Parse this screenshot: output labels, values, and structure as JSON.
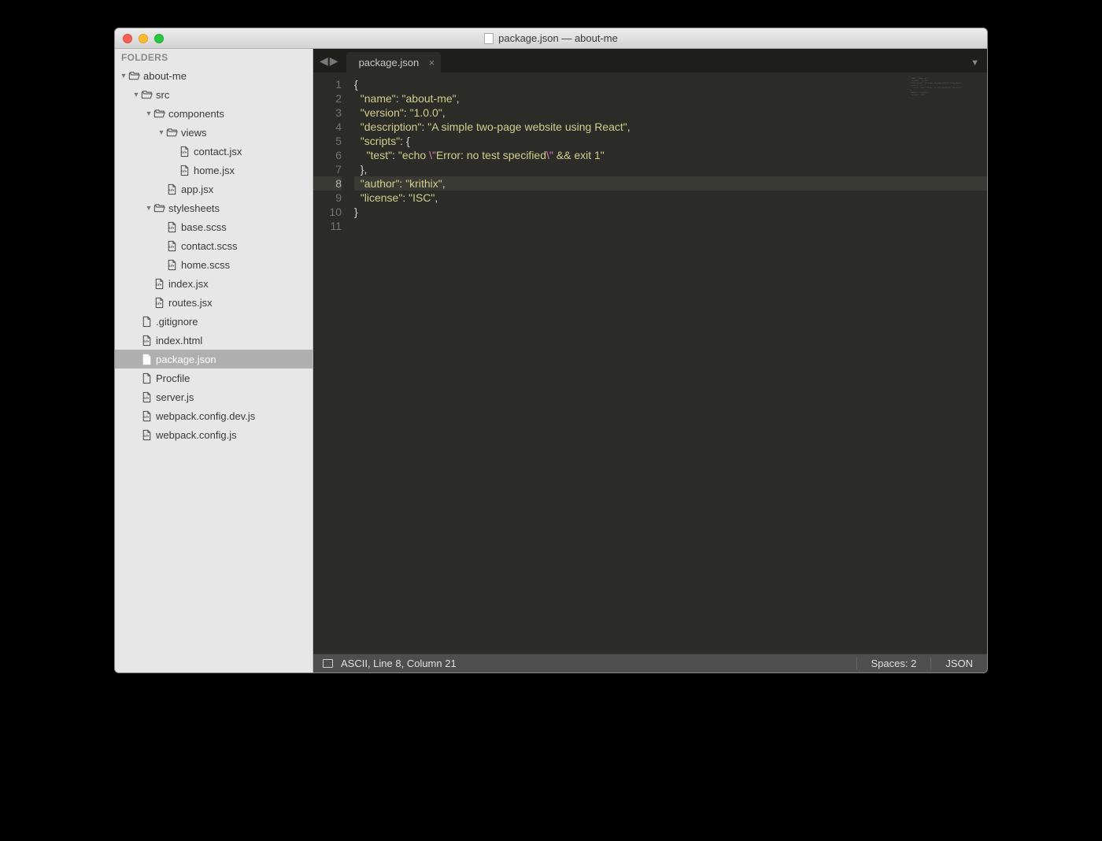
{
  "window": {
    "title": "package.json — about-me"
  },
  "sidebar": {
    "header": "FOLDERS",
    "tree": [
      {
        "depth": 0,
        "kind": "folder",
        "open": true,
        "name": "about-me"
      },
      {
        "depth": 1,
        "kind": "folder",
        "open": true,
        "name": "src"
      },
      {
        "depth": 2,
        "kind": "folder",
        "open": true,
        "name": "components"
      },
      {
        "depth": 3,
        "kind": "folder",
        "open": true,
        "name": "views"
      },
      {
        "depth": 4,
        "kind": "file-code",
        "name": "contact.jsx"
      },
      {
        "depth": 4,
        "kind": "file-code",
        "name": "home.jsx"
      },
      {
        "depth": 3,
        "kind": "file-code",
        "name": "app.jsx"
      },
      {
        "depth": 2,
        "kind": "folder",
        "open": true,
        "name": "stylesheets"
      },
      {
        "depth": 3,
        "kind": "file-code",
        "name": "base.scss"
      },
      {
        "depth": 3,
        "kind": "file-code",
        "name": "contact.scss"
      },
      {
        "depth": 3,
        "kind": "file-code",
        "name": "home.scss"
      },
      {
        "depth": 2,
        "kind": "file-code",
        "name": "index.jsx"
      },
      {
        "depth": 2,
        "kind": "file-code",
        "name": "routes.jsx"
      },
      {
        "depth": 1,
        "kind": "file",
        "name": ".gitignore"
      },
      {
        "depth": 1,
        "kind": "file-code",
        "name": "index.html"
      },
      {
        "depth": 1,
        "kind": "file-code",
        "name": "package.json",
        "selected": true
      },
      {
        "depth": 1,
        "kind": "file",
        "name": "Procfile"
      },
      {
        "depth": 1,
        "kind": "file-code",
        "name": "server.js"
      },
      {
        "depth": 1,
        "kind": "file-code",
        "name": "webpack.config.dev.js"
      },
      {
        "depth": 1,
        "kind": "file-code",
        "name": "webpack.config.js"
      }
    ]
  },
  "tabs": {
    "active": "package.json"
  },
  "editor": {
    "highlighted_line": 8,
    "line_count": 11,
    "lines": [
      [
        {
          "t": "{",
          "c": "punc"
        }
      ],
      [
        {
          "t": "  ",
          "c": "punc"
        },
        {
          "t": "\"name\"",
          "c": "str"
        },
        {
          "t": ": ",
          "c": "punc"
        },
        {
          "t": "\"about-me\"",
          "c": "str"
        },
        {
          "t": ",",
          "c": "punc"
        }
      ],
      [
        {
          "t": "  ",
          "c": "punc"
        },
        {
          "t": "\"version\"",
          "c": "str"
        },
        {
          "t": ": ",
          "c": "punc"
        },
        {
          "t": "\"1.0.0\"",
          "c": "str"
        },
        {
          "t": ",",
          "c": "punc"
        }
      ],
      [
        {
          "t": "  ",
          "c": "punc"
        },
        {
          "t": "\"description\"",
          "c": "str"
        },
        {
          "t": ": ",
          "c": "punc"
        },
        {
          "t": "\"A simple two-page website using React\"",
          "c": "str"
        },
        {
          "t": ",",
          "c": "punc"
        }
      ],
      [
        {
          "t": "  ",
          "c": "punc"
        },
        {
          "t": "\"scripts\"",
          "c": "str"
        },
        {
          "t": ": {",
          "c": "punc"
        }
      ],
      [
        {
          "t": "    ",
          "c": "punc"
        },
        {
          "t": "\"test\"",
          "c": "str"
        },
        {
          "t": ": ",
          "c": "punc"
        },
        {
          "t": "\"echo ",
          "c": "str"
        },
        {
          "t": "\\\"",
          "c": "esc"
        },
        {
          "t": "Error: no test specified",
          "c": "str"
        },
        {
          "t": "\\\"",
          "c": "esc"
        },
        {
          "t": " && exit 1\"",
          "c": "str"
        }
      ],
      [
        {
          "t": "  },",
          "c": "punc"
        }
      ],
      [
        {
          "t": "  ",
          "c": "punc"
        },
        {
          "t": "\"author\"",
          "c": "str"
        },
        {
          "t": ": ",
          "c": "punc"
        },
        {
          "t": "\"krithix\"",
          "c": "str"
        },
        {
          "t": ",",
          "c": "punc"
        }
      ],
      [
        {
          "t": "  ",
          "c": "punc"
        },
        {
          "t": "\"license\"",
          "c": "str"
        },
        {
          "t": ": ",
          "c": "punc"
        },
        {
          "t": "\"ISC\"",
          "c": "str"
        },
        {
          "t": ",",
          "c": "punc"
        }
      ],
      [
        {
          "t": "}",
          "c": "punc"
        }
      ],
      []
    ]
  },
  "status": {
    "left": "ASCII, Line 8, Column 21",
    "spaces": "Spaces: 2",
    "syntax": "JSON"
  }
}
